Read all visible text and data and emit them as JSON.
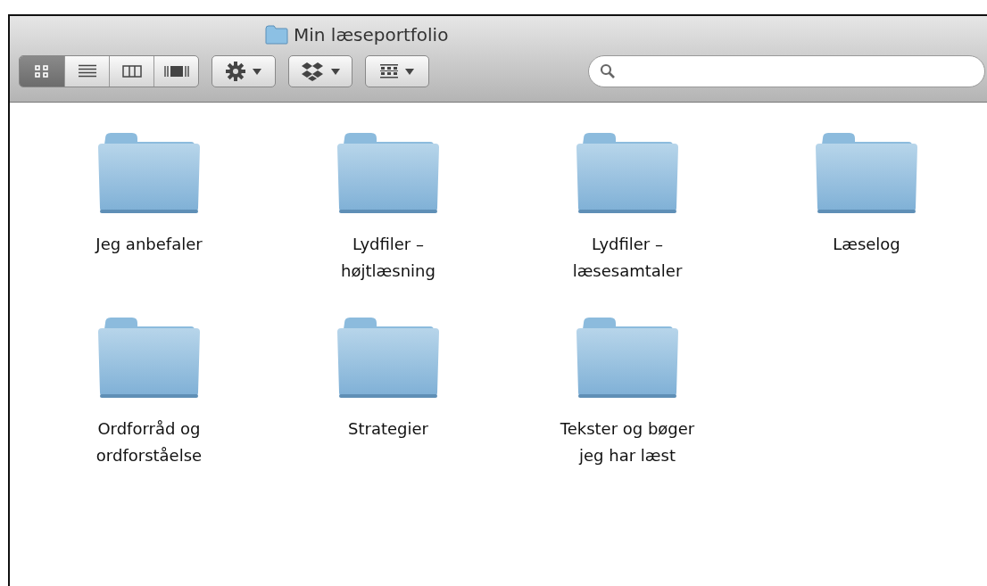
{
  "window": {
    "title": "Min læseportfolio"
  },
  "toolbar": {
    "view_modes": [
      {
        "kind": "icon",
        "selected": true
      },
      {
        "kind": "list",
        "selected": false
      },
      {
        "kind": "columns",
        "selected": false
      },
      {
        "kind": "coverflow",
        "selected": false
      }
    ],
    "buttons": [
      {
        "kind": "action"
      },
      {
        "kind": "dropbox"
      },
      {
        "kind": "arrange"
      }
    ]
  },
  "folders": [
    {
      "name": "Jeg anbefaler"
    },
    {
      "name": "Lydfiler – højtlæsning"
    },
    {
      "name": "Lydfiler – læsesamtaler"
    },
    {
      "name": "Læselog"
    },
    {
      "name": "Ordforråd og ordforståelse"
    },
    {
      "name": "Strategier"
    },
    {
      "name": "Tekster og bøger jeg har læst"
    }
  ]
}
